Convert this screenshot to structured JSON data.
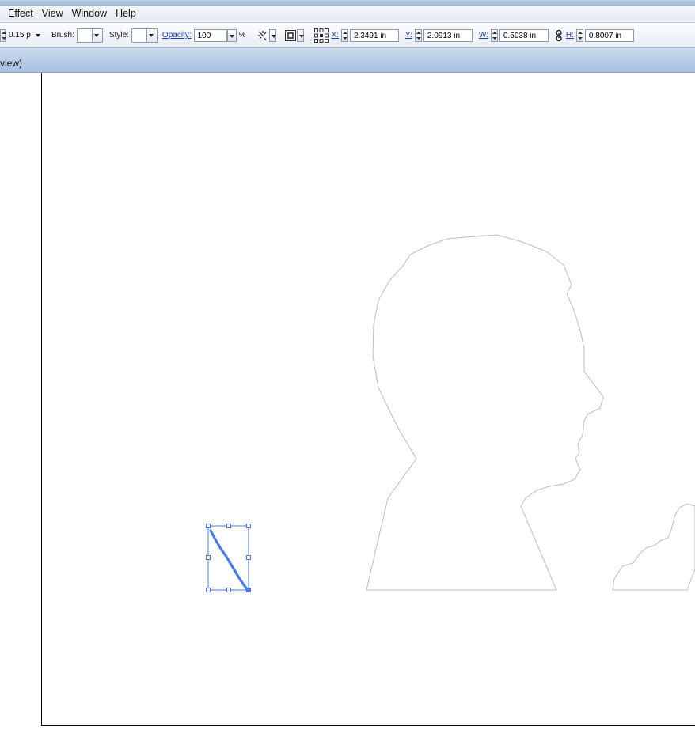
{
  "menu": {
    "items": [
      "Effect",
      "View",
      "Window",
      "Help"
    ]
  },
  "control_bar": {
    "stroke_weight": "0.15 p",
    "brush_label": "Brush:",
    "style_label": "Style:",
    "opacity_label": "Opacity:",
    "opacity_value": "100",
    "opacity_unit": "%",
    "x_label": "X:",
    "x_value": "2.3491 in",
    "y_label": "Y:",
    "y_value": "2.0913 in",
    "w_label": "W:",
    "w_value": "0.5038 in",
    "h_label": "H:",
    "h_value": "0.8007 in"
  },
  "document": {
    "tab_text": "view)"
  },
  "icons": {
    "recolor": "recolor-artwork-icon",
    "align": "align-icon",
    "reference_point": "reference-point-icon",
    "link": "constrain-proportions-link-icon"
  },
  "colors": {
    "selection": "#4a7be6",
    "outline": "#bdbdbd",
    "link": "#1d3fbf"
  }
}
